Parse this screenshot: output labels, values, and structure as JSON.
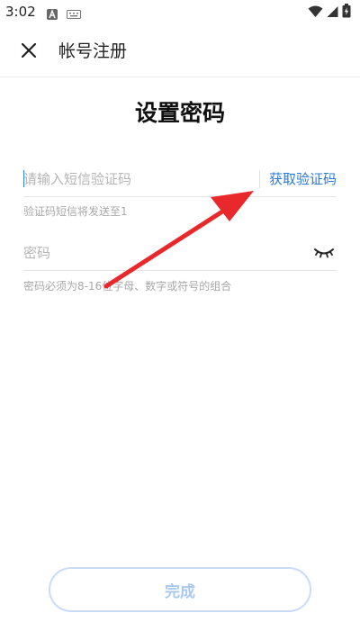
{
  "status_bar": {
    "time": "3:02",
    "icons": [
      "notification-a-icon",
      "keyboard-icon",
      "wifi-icon",
      "signal-icon",
      "battery-charging-icon"
    ]
  },
  "app_bar": {
    "close_icon": "close-icon",
    "title": "帐号注册"
  },
  "page_title": "设置密码",
  "code_field": {
    "placeholder": "请输入短信验证码",
    "value": "",
    "get_code_label": "获取验证码",
    "hint": "验证码短信将发送至1"
  },
  "password_field": {
    "placeholder": "密码",
    "value": "",
    "toggle_icon": "eye-closed-icon",
    "hint": "密码必须为8-16位字母、数字或符号的组合"
  },
  "annotation": {
    "type": "arrow",
    "color": "#e8282b",
    "points_to": "get-code-button"
  },
  "done_button": {
    "label": "完成",
    "enabled": false
  },
  "colors": {
    "accent": "#2d7ad6",
    "disabled_text": "#a8c8ef",
    "disabled_border": "#c8dcf6",
    "hint_text": "#a8a8a8"
  }
}
